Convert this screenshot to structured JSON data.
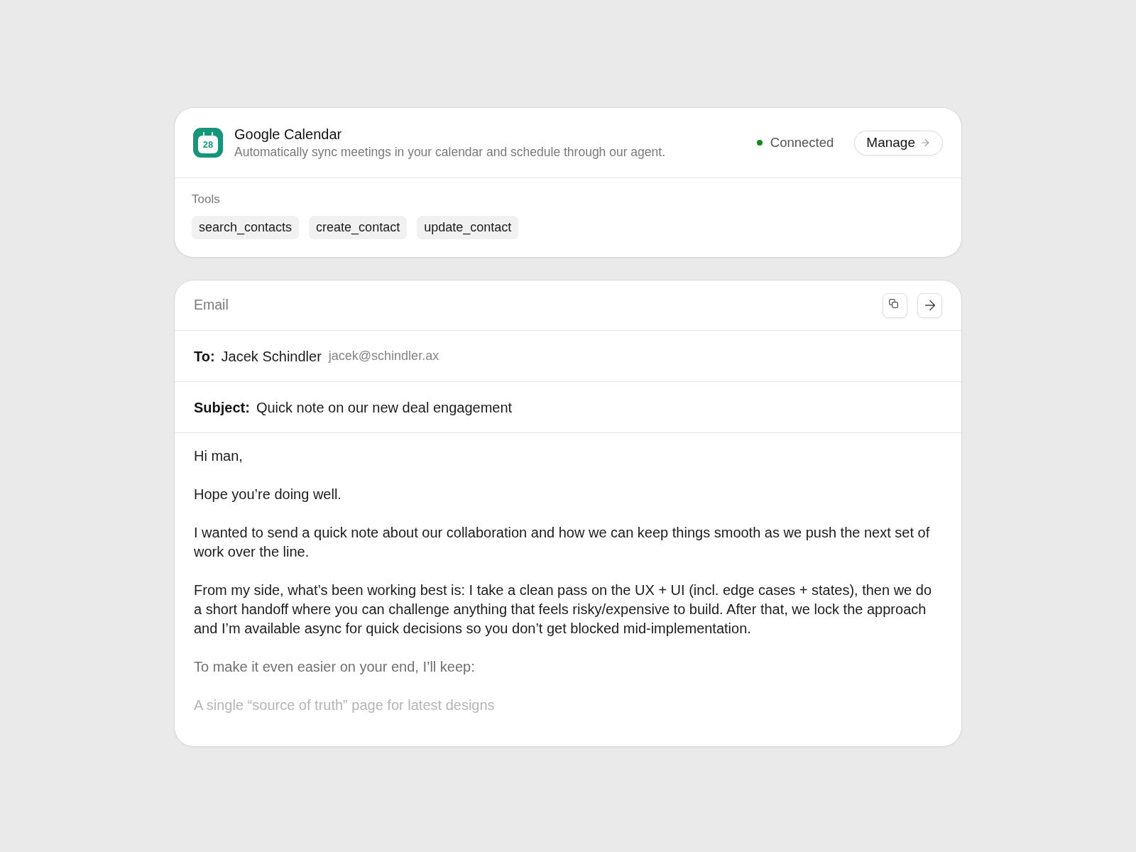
{
  "integration": {
    "logo_date": "28",
    "name": "Google Calendar",
    "description": "Automatically sync meetings in your calendar and schedule through our agent.",
    "connected": true,
    "status_label": "Connected",
    "manage_button": "Manage",
    "tools_label": "Tools",
    "tools": [
      "search_contacts",
      "create_contact",
      "update_contact"
    ]
  },
  "email": {
    "title": "Email",
    "to": {
      "label": "To:",
      "name": "Jacek Schindler",
      "address": "jacek@schindler.ax"
    },
    "subject": {
      "label": "Subject:",
      "value": "Quick note on our new deal engagement"
    },
    "body": [
      {
        "text": "Hi man,",
        "kind": "normal"
      },
      {
        "text": "Hope you’re doing well.",
        "kind": "normal"
      },
      {
        "text": "I wanted to send a quick note about our collaboration and how we can keep things smooth as we push the next set of work over the line.",
        "kind": "normal"
      },
      {
        "text": "From my side, what’s been working best is: I take a clean pass on the UX + UI (incl. edge cases + states), then we do a short handoff where you can challenge anything that feels risky/expensive to build. After that, we lock the approach and I’m available async for quick decisions so you don’t get blocked mid-implementation.",
        "kind": "normal"
      },
      {
        "text": "To make it even easier on your end, I’ll keep:",
        "kind": "muted"
      },
      {
        "text": "A single “source of truth” page for latest designs",
        "kind": "faint"
      }
    ]
  }
}
